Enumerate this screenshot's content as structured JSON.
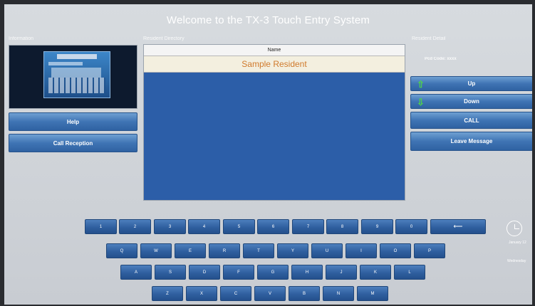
{
  "title": "Welcome to the TX-3 Touch Entry System",
  "sections": {
    "information": "Information",
    "directory": "Resident Directory",
    "detail": "Resident Detail"
  },
  "left": {
    "help": "Help",
    "call_reception": "Call Reception"
  },
  "directory": {
    "column": "Name",
    "rows": [
      "Sample Resident"
    ]
  },
  "detail": {
    "pcode_label": "Pcd Code: xxxx"
  },
  "right": {
    "up": "Up",
    "down": "Down",
    "call": "CALL",
    "leave": "Leave Message"
  },
  "keyboard": {
    "numbers": [
      "1",
      "2",
      "3",
      "4",
      "5",
      "6",
      "7",
      "8",
      "9",
      "0"
    ],
    "row1": [
      "Q",
      "W",
      "E",
      "R",
      "T",
      "Y",
      "U",
      "I",
      "O",
      "P"
    ],
    "row2": [
      "A",
      "S",
      "D",
      "F",
      "G",
      "H",
      "J",
      "K",
      "L"
    ],
    "row3": [
      "Z",
      "X",
      "C",
      "V",
      "B",
      "N",
      "M"
    ]
  },
  "datetime": {
    "date": "January 12",
    "day": "Wednesday"
  },
  "colors": {
    "accent_blue": "#2c5ea8",
    "resident_text": "#d07a2c",
    "arrow_green": "#4fd14c"
  }
}
